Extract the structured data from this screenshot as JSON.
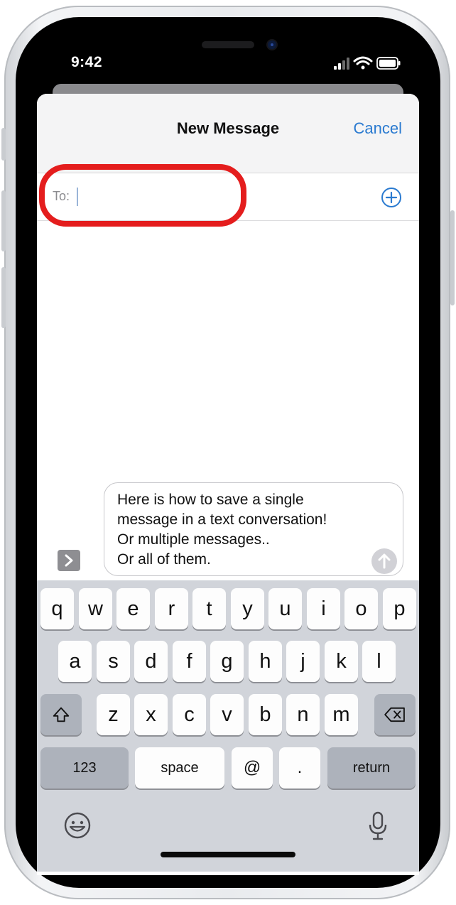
{
  "status_bar": {
    "time": "9:42"
  },
  "nav": {
    "title": "New Message",
    "cancel_label": "Cancel"
  },
  "recipients": {
    "label": "To:",
    "value": "",
    "add_icon": "plus-circle-icon"
  },
  "compose": {
    "text": "Here is how to save a single\nmessage in a text conversation!\nOr multiple messages..\nOr all of them.",
    "send_icon": "arrow-up-icon",
    "apps_icon": "chevron-right-icon"
  },
  "annotation": {
    "color": "#e41d1d"
  },
  "keyboard": {
    "row1": [
      "q",
      "w",
      "e",
      "r",
      "t",
      "y",
      "u",
      "i",
      "o",
      "p"
    ],
    "row2": [
      "a",
      "s",
      "d",
      "f",
      "g",
      "h",
      "j",
      "k",
      "l"
    ],
    "row3": [
      "z",
      "x",
      "c",
      "v",
      "b",
      "n",
      "m"
    ],
    "shift_icon": "shift-icon",
    "delete_icon": "delete-icon",
    "numbers_label": "123",
    "space_label": "space",
    "at_label": "@",
    "period_label": ".",
    "return_label": "return",
    "emoji_icon": "emoji-icon",
    "dictation_icon": "microphone-icon"
  },
  "colors": {
    "accent": "#2a7ad0",
    "keyboard_bg": "#d1d4da",
    "function_key": "#adb2bb"
  }
}
